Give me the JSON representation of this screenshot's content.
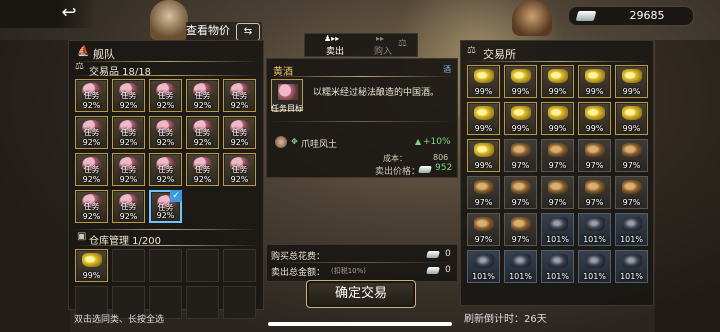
{
  "topbar": {
    "view_price_label": "查看物价",
    "swap_glyph": "⇆",
    "currency_value": "29685",
    "back_glyph": "↩"
  },
  "fleet_panel": {
    "title": "舰队",
    "trade_goods_header": "交易品 18/18",
    "warehouse_header": "仓库管理 1/200",
    "hint": "双击选同类、长按全选",
    "items": [
      {
        "label": "任务",
        "pct": "92%",
        "selected": false
      },
      {
        "label": "任务",
        "pct": "92%",
        "selected": false
      },
      {
        "label": "任务",
        "pct": "92%",
        "selected": false
      },
      {
        "label": "任务",
        "pct": "92%",
        "selected": false
      },
      {
        "label": "任务",
        "pct": "92%",
        "selected": false
      },
      {
        "label": "任务",
        "pct": "92%",
        "selected": false
      },
      {
        "label": "任务",
        "pct": "92%",
        "selected": false
      },
      {
        "label": "任务",
        "pct": "92%",
        "selected": false
      },
      {
        "label": "任务",
        "pct": "92%",
        "selected": false
      },
      {
        "label": "任务",
        "pct": "92%",
        "selected": false
      },
      {
        "label": "任务",
        "pct": "92%",
        "selected": false
      },
      {
        "label": "任务",
        "pct": "92%",
        "selected": false
      },
      {
        "label": "任务",
        "pct": "92%",
        "selected": false
      },
      {
        "label": "任务",
        "pct": "92%",
        "selected": false
      },
      {
        "label": "任务",
        "pct": "92%",
        "selected": false
      },
      {
        "label": "任务",
        "pct": "92%",
        "selected": false
      },
      {
        "label": "任务",
        "pct": "92%",
        "selected": false
      },
      {
        "label": "任务",
        "pct": "92%",
        "selected": true
      }
    ],
    "warehouse_item": {
      "pct": "99%"
    }
  },
  "trade_tabs": {
    "sell": "卖出",
    "buy": "购入"
  },
  "detail": {
    "item_name": "黄酒",
    "category": "酒",
    "description": "以糯米经过秘法酿造的中国酒。",
    "item_tag": "任务目标",
    "skill_name": "爪哇风土",
    "skill_bonus": "+10%",
    "cost_label": "成本：",
    "cost_value": "806",
    "sell_price_label": "卖出价格：",
    "sell_price_value": "952"
  },
  "summary": {
    "buy_total_label": "购买总花费：",
    "buy_total_value": "0",
    "sell_total_label": "卖出总金额：",
    "sell_total_note": "(扣税10%)",
    "sell_total_value": "0"
  },
  "confirm_button": "确定交易",
  "exchange_panel": {
    "title": "交易所",
    "refresh_label": "刷新倒计时：",
    "refresh_value": "26天",
    "items": [
      {
        "type": "gold",
        "pct": "99%"
      },
      {
        "type": "gold",
        "pct": "99%"
      },
      {
        "type": "gold",
        "pct": "99%"
      },
      {
        "type": "gold",
        "pct": "99%"
      },
      {
        "type": "gold",
        "pct": "99%"
      },
      {
        "type": "gold",
        "pct": "99%"
      },
      {
        "type": "gold",
        "pct": "99%"
      },
      {
        "type": "gold",
        "pct": "99%"
      },
      {
        "type": "gold",
        "pct": "99%"
      },
      {
        "type": "gold",
        "pct": "99%"
      },
      {
        "type": "gold",
        "pct": "99%"
      },
      {
        "type": "brown",
        "pct": "97%"
      },
      {
        "type": "brown",
        "pct": "97%"
      },
      {
        "type": "brown",
        "pct": "97%"
      },
      {
        "type": "brown",
        "pct": "97%"
      },
      {
        "type": "brown",
        "pct": "97%"
      },
      {
        "type": "brown",
        "pct": "97%"
      },
      {
        "type": "brown",
        "pct": "97%"
      },
      {
        "type": "brown",
        "pct": "97%"
      },
      {
        "type": "brown",
        "pct": "97%"
      },
      {
        "type": "brown",
        "pct": "97%"
      },
      {
        "type": "brown",
        "pct": "97%"
      },
      {
        "type": "dark",
        "pct": "101%"
      },
      {
        "type": "dark",
        "pct": "101%"
      },
      {
        "type": "dark",
        "pct": "101%"
      },
      {
        "type": "dark",
        "pct": "101%"
      },
      {
        "type": "dark",
        "pct": "101%"
      },
      {
        "type": "dark",
        "pct": "101%"
      },
      {
        "type": "dark",
        "pct": "101%"
      },
      {
        "type": "dark",
        "pct": "101%"
      }
    ]
  },
  "colors": {
    "accent_green": "#7fd67a",
    "select_blue": "#6fc3ff",
    "gold_border": "#b89a4a"
  }
}
